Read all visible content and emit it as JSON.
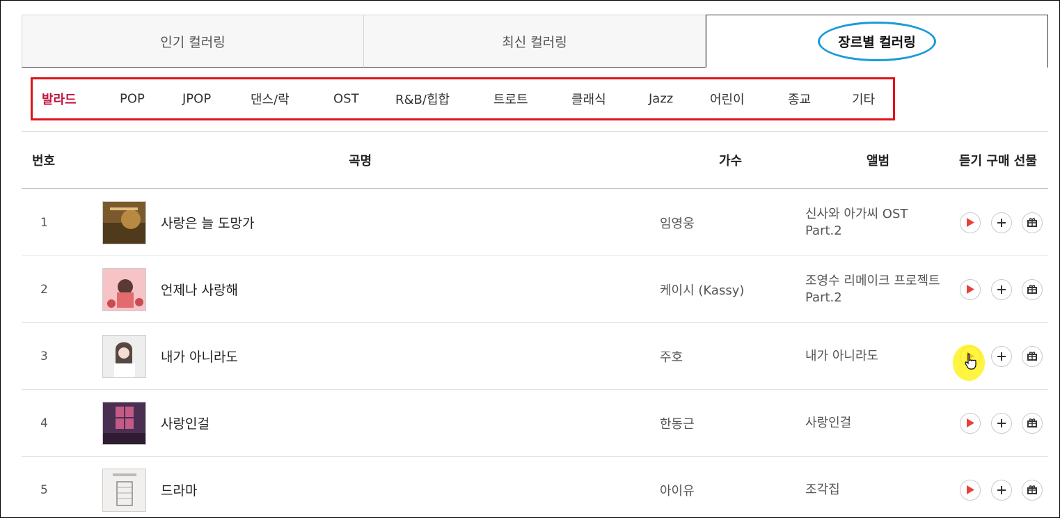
{
  "tabs": [
    {
      "label": "인기 컬러링"
    },
    {
      "label": "최신 컬러링"
    },
    {
      "label": "장르별 컬러링"
    }
  ],
  "genres": [
    {
      "label": "발라드"
    },
    {
      "label": "POP"
    },
    {
      "label": "JPOP"
    },
    {
      "label": "댄스/락"
    },
    {
      "label": "OST"
    },
    {
      "label": "R&B/힙합"
    },
    {
      "label": "트로트"
    },
    {
      "label": "클래식"
    },
    {
      "label": "Jazz"
    },
    {
      "label": "어린이"
    },
    {
      "label": "종교"
    },
    {
      "label": "기타"
    }
  ],
  "table": {
    "headers": {
      "num": "번호",
      "title": "곡명",
      "artist": "가수",
      "album": "앨범",
      "actions": "듣기 구매 선물"
    },
    "rows": [
      {
        "num": "1",
        "title": "사랑은 늘 도망가",
        "artist": "임영웅",
        "album": "신사와 아가씨 OST Part.2"
      },
      {
        "num": "2",
        "title": "언제나 사랑해",
        "artist": "케이시 (Kassy)",
        "album": "조영수 리메이크 프로젝트 Part.2"
      },
      {
        "num": "3",
        "title": "내가 아니라도",
        "artist": "주호",
        "album": "내가 아니라도"
      },
      {
        "num": "4",
        "title": "사랑인걸",
        "artist": "한동근",
        "album": "사랑인걸"
      },
      {
        "num": "5",
        "title": "드라마",
        "artist": "아이유",
        "album": "조각집"
      }
    ]
  },
  "colors": {
    "active_genre": "#c4133f",
    "genre_box": "#e0111b",
    "tab_highlight": "#1a9bd7",
    "play_icon": "#e8403a"
  },
  "icons": {
    "play": "play-icon",
    "add": "plus-icon",
    "gift": "gift-icon"
  }
}
